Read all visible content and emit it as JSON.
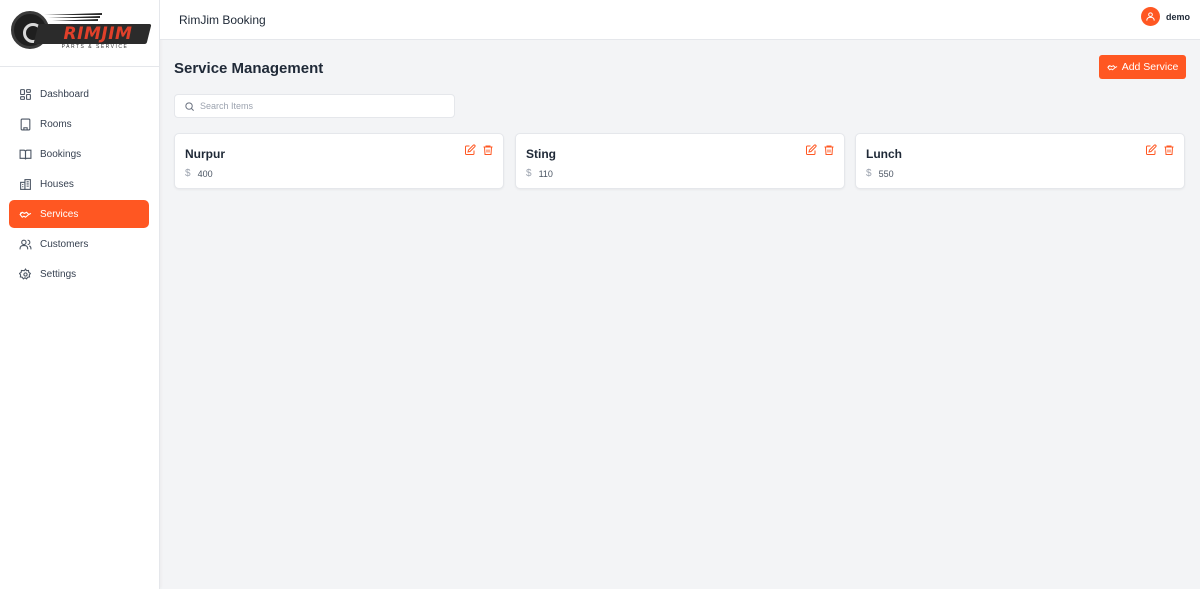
{
  "app": {
    "title": "RimJim Booking"
  },
  "logo": {
    "text": "RIMJIM",
    "subtext": "PARTS & SERVICE"
  },
  "user": {
    "name": "demo"
  },
  "sidebar": {
    "items": [
      {
        "label": "Dashboard",
        "icon": "dashboard-icon"
      },
      {
        "label": "Rooms",
        "icon": "building-icon"
      },
      {
        "label": "Bookings",
        "icon": "book-icon"
      },
      {
        "label": "Houses",
        "icon": "houses-icon"
      },
      {
        "label": "Services",
        "icon": "handshake-icon",
        "active": true
      },
      {
        "label": "Customers",
        "icon": "users-icon"
      },
      {
        "label": "Settings",
        "icon": "gear-icon"
      }
    ]
  },
  "main": {
    "title": "Service Management",
    "add_button_label": "Add Service",
    "search": {
      "placeholder": "Search Items",
      "value": ""
    },
    "cards": [
      {
        "name": "Nurpur",
        "currency": "$",
        "price": "400"
      },
      {
        "name": "Sting",
        "currency": "$",
        "price": "110"
      },
      {
        "name": "Lunch",
        "currency": "$",
        "price": "550"
      }
    ]
  },
  "colors": {
    "accent": "#ff5722",
    "background": "#f3f4f6",
    "surface": "#ffffff"
  }
}
